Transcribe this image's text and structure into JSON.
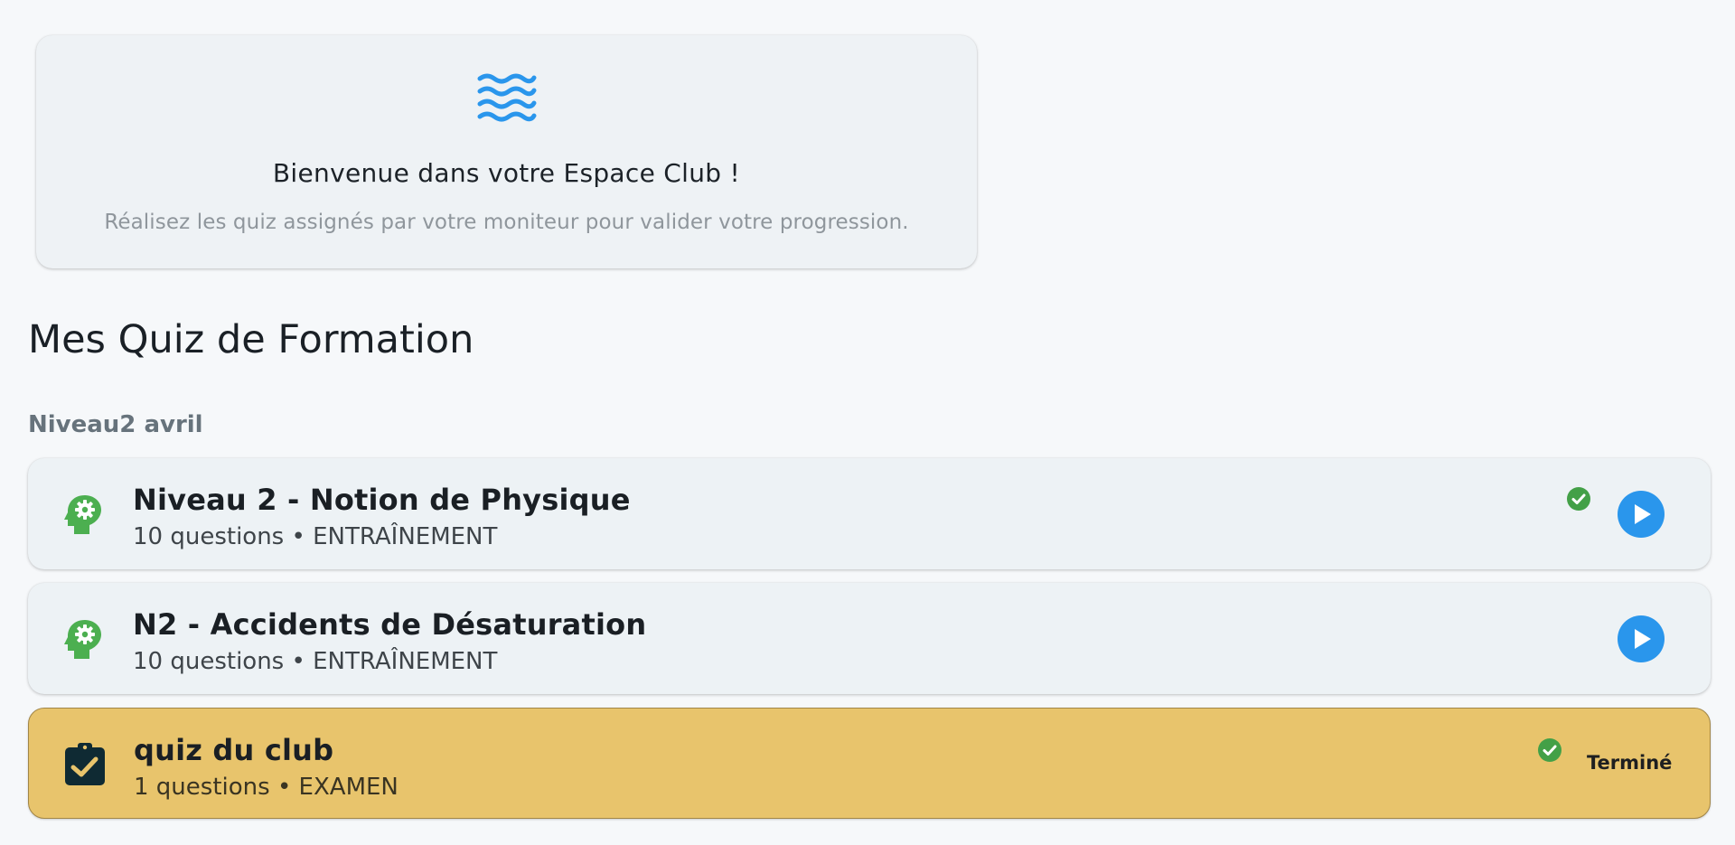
{
  "welcome": {
    "icon": "waves-icon",
    "title": "Bienvenue dans votre Espace Club !",
    "subtitle": "Réalisez les quiz assignés par votre moniteur pour valider votre progression."
  },
  "section": {
    "title": "Mes Quiz de Formation",
    "group_label": "Niveau2 avril"
  },
  "quizzes": [
    {
      "title": "Niveau 2 - Notion de Physique",
      "meta": "10 questions • ENTRAÎNEMENT",
      "icon": "psychology-icon",
      "completed": true,
      "action": "play-button"
    },
    {
      "title": "N2 - Accidents de Désaturation",
      "meta": "10 questions • ENTRAÎNEMENT",
      "icon": "psychology-icon",
      "completed": false,
      "action": "play-button"
    },
    {
      "title": "quiz du club",
      "meta": "1 questions • EXAMEN",
      "icon": "assignment-turned-in-icon",
      "completed": true,
      "status": "Terminé"
    }
  ],
  "colors": {
    "background": "#f6f8fa",
    "card": "#edf2f5",
    "exam_card": "#e8c46c",
    "accent_blue": "#2a96ec",
    "success_green": "#43a047",
    "training_icon_green": "#4caf50",
    "exam_icon_dark": "#0f2a33"
  }
}
